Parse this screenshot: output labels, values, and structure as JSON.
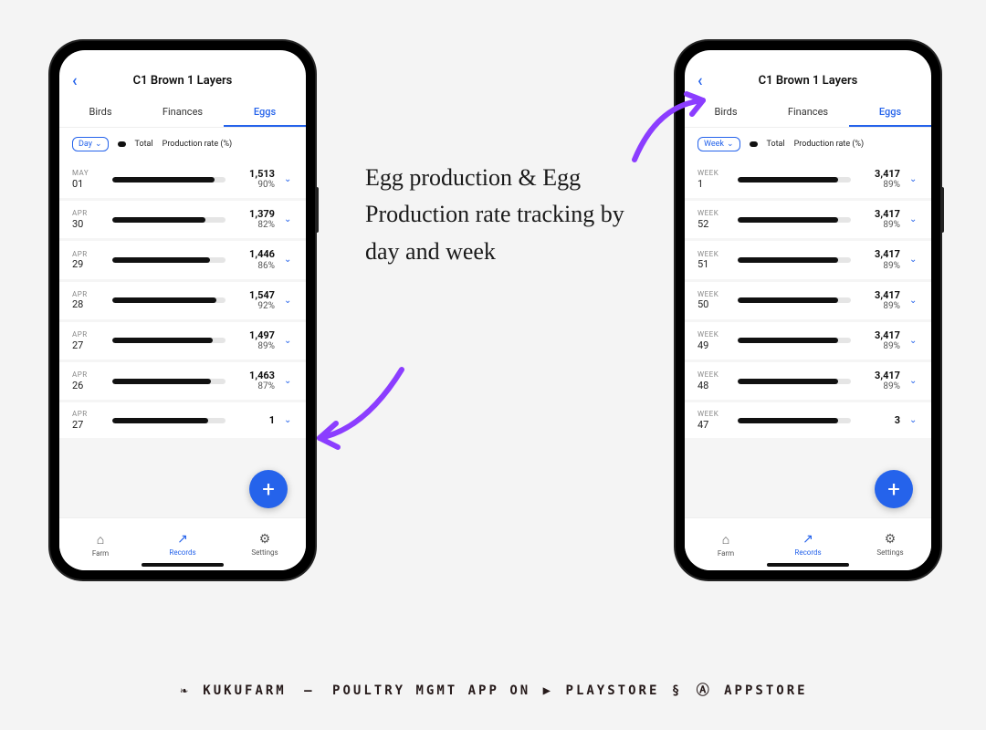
{
  "annotation": {
    "text": "Egg production & Egg Production rate tracking by day and week"
  },
  "footer": {
    "brand": "KUKUFARM",
    "tagline": "POULTRY MGMT APP",
    "on": "ON",
    "playstore": "PLAYSTORE",
    "appstore": "APPSTORE"
  },
  "phone_common": {
    "title": "C1 Brown 1 Layers",
    "tabs": {
      "birds": "Birds",
      "finances": "Finances",
      "eggs": "Eggs"
    },
    "legend_total": "Total",
    "legend_rate": "Production rate (%)",
    "nav": {
      "farm": "Farm",
      "records": "Records",
      "settings": "Settings"
    }
  },
  "phones": {
    "left": {
      "filter_label": "Day",
      "rows": [
        {
          "period_label": "MAY",
          "period_value": "01",
          "total": "1,513",
          "pct": "90%",
          "bar": 90
        },
        {
          "period_label": "APR",
          "period_value": "30",
          "total": "1,379",
          "pct": "82%",
          "bar": 82
        },
        {
          "period_label": "APR",
          "period_value": "29",
          "total": "1,446",
          "pct": "86%",
          "bar": 86
        },
        {
          "period_label": "APR",
          "period_value": "28",
          "total": "1,547",
          "pct": "92%",
          "bar": 92
        },
        {
          "period_label": "APR",
          "period_value": "27",
          "total": "1,497",
          "pct": "89%",
          "bar": 89
        },
        {
          "period_label": "APR",
          "period_value": "26",
          "total": "1,463",
          "pct": "87%",
          "bar": 87
        },
        {
          "period_label": "APR",
          "period_value": "27",
          "total": "1",
          "pct": "",
          "bar": 85
        }
      ]
    },
    "right": {
      "filter_label": "Week",
      "rows": [
        {
          "period_label": "WEEK",
          "period_value": "1",
          "total": "3,417",
          "pct": "89%",
          "bar": 89
        },
        {
          "period_label": "WEEK",
          "period_value": "52",
          "total": "3,417",
          "pct": "89%",
          "bar": 89
        },
        {
          "period_label": "WEEK",
          "period_value": "51",
          "total": "3,417",
          "pct": "89%",
          "bar": 89
        },
        {
          "period_label": "WEEK",
          "period_value": "50",
          "total": "3,417",
          "pct": "89%",
          "bar": 89
        },
        {
          "period_label": "WEEK",
          "period_value": "49",
          "total": "3,417",
          "pct": "89%",
          "bar": 89
        },
        {
          "period_label": "WEEK",
          "period_value": "48",
          "total": "3,417",
          "pct": "89%",
          "bar": 89
        },
        {
          "period_label": "WEEK",
          "period_value": "47",
          "total": "3",
          "pct": "",
          "bar": 89
        }
      ]
    }
  }
}
